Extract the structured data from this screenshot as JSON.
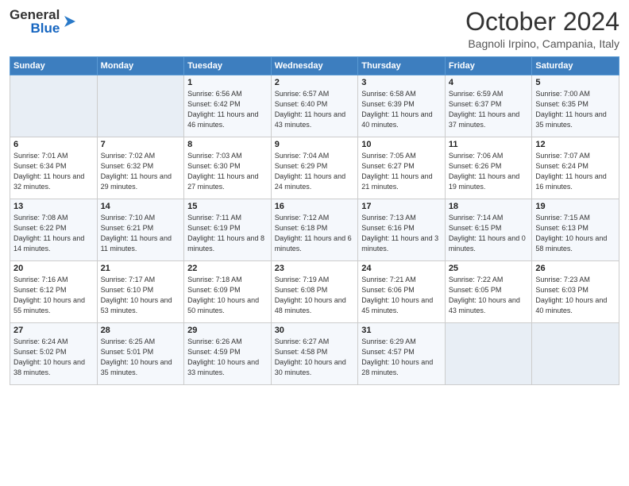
{
  "header": {
    "logo_line1": "General",
    "logo_line2": "Blue",
    "month": "October 2024",
    "location": "Bagnoli Irpino, Campania, Italy"
  },
  "weekdays": [
    "Sunday",
    "Monday",
    "Tuesday",
    "Wednesday",
    "Thursday",
    "Friday",
    "Saturday"
  ],
  "weeks": [
    [
      {
        "day": "",
        "info": ""
      },
      {
        "day": "",
        "info": ""
      },
      {
        "day": "1",
        "info": "Sunrise: 6:56 AM\nSunset: 6:42 PM\nDaylight: 11 hours and 46 minutes."
      },
      {
        "day": "2",
        "info": "Sunrise: 6:57 AM\nSunset: 6:40 PM\nDaylight: 11 hours and 43 minutes."
      },
      {
        "day": "3",
        "info": "Sunrise: 6:58 AM\nSunset: 6:39 PM\nDaylight: 11 hours and 40 minutes."
      },
      {
        "day": "4",
        "info": "Sunrise: 6:59 AM\nSunset: 6:37 PM\nDaylight: 11 hours and 37 minutes."
      },
      {
        "day": "5",
        "info": "Sunrise: 7:00 AM\nSunset: 6:35 PM\nDaylight: 11 hours and 35 minutes."
      }
    ],
    [
      {
        "day": "6",
        "info": "Sunrise: 7:01 AM\nSunset: 6:34 PM\nDaylight: 11 hours and 32 minutes."
      },
      {
        "day": "7",
        "info": "Sunrise: 7:02 AM\nSunset: 6:32 PM\nDaylight: 11 hours and 29 minutes."
      },
      {
        "day": "8",
        "info": "Sunrise: 7:03 AM\nSunset: 6:30 PM\nDaylight: 11 hours and 27 minutes."
      },
      {
        "day": "9",
        "info": "Sunrise: 7:04 AM\nSunset: 6:29 PM\nDaylight: 11 hours and 24 minutes."
      },
      {
        "day": "10",
        "info": "Sunrise: 7:05 AM\nSunset: 6:27 PM\nDaylight: 11 hours and 21 minutes."
      },
      {
        "day": "11",
        "info": "Sunrise: 7:06 AM\nSunset: 6:26 PM\nDaylight: 11 hours and 19 minutes."
      },
      {
        "day": "12",
        "info": "Sunrise: 7:07 AM\nSunset: 6:24 PM\nDaylight: 11 hours and 16 minutes."
      }
    ],
    [
      {
        "day": "13",
        "info": "Sunrise: 7:08 AM\nSunset: 6:22 PM\nDaylight: 11 hours and 14 minutes."
      },
      {
        "day": "14",
        "info": "Sunrise: 7:10 AM\nSunset: 6:21 PM\nDaylight: 11 hours and 11 minutes."
      },
      {
        "day": "15",
        "info": "Sunrise: 7:11 AM\nSunset: 6:19 PM\nDaylight: 11 hours and 8 minutes."
      },
      {
        "day": "16",
        "info": "Sunrise: 7:12 AM\nSunset: 6:18 PM\nDaylight: 11 hours and 6 minutes."
      },
      {
        "day": "17",
        "info": "Sunrise: 7:13 AM\nSunset: 6:16 PM\nDaylight: 11 hours and 3 minutes."
      },
      {
        "day": "18",
        "info": "Sunrise: 7:14 AM\nSunset: 6:15 PM\nDaylight: 11 hours and 0 minutes."
      },
      {
        "day": "19",
        "info": "Sunrise: 7:15 AM\nSunset: 6:13 PM\nDaylight: 10 hours and 58 minutes."
      }
    ],
    [
      {
        "day": "20",
        "info": "Sunrise: 7:16 AM\nSunset: 6:12 PM\nDaylight: 10 hours and 55 minutes."
      },
      {
        "day": "21",
        "info": "Sunrise: 7:17 AM\nSunset: 6:10 PM\nDaylight: 10 hours and 53 minutes."
      },
      {
        "day": "22",
        "info": "Sunrise: 7:18 AM\nSunset: 6:09 PM\nDaylight: 10 hours and 50 minutes."
      },
      {
        "day": "23",
        "info": "Sunrise: 7:19 AM\nSunset: 6:08 PM\nDaylight: 10 hours and 48 minutes."
      },
      {
        "day": "24",
        "info": "Sunrise: 7:21 AM\nSunset: 6:06 PM\nDaylight: 10 hours and 45 minutes."
      },
      {
        "day": "25",
        "info": "Sunrise: 7:22 AM\nSunset: 6:05 PM\nDaylight: 10 hours and 43 minutes."
      },
      {
        "day": "26",
        "info": "Sunrise: 7:23 AM\nSunset: 6:03 PM\nDaylight: 10 hours and 40 minutes."
      }
    ],
    [
      {
        "day": "27",
        "info": "Sunrise: 6:24 AM\nSunset: 5:02 PM\nDaylight: 10 hours and 38 minutes."
      },
      {
        "day": "28",
        "info": "Sunrise: 6:25 AM\nSunset: 5:01 PM\nDaylight: 10 hours and 35 minutes."
      },
      {
        "day": "29",
        "info": "Sunrise: 6:26 AM\nSunset: 4:59 PM\nDaylight: 10 hours and 33 minutes."
      },
      {
        "day": "30",
        "info": "Sunrise: 6:27 AM\nSunset: 4:58 PM\nDaylight: 10 hours and 30 minutes."
      },
      {
        "day": "31",
        "info": "Sunrise: 6:29 AM\nSunset: 4:57 PM\nDaylight: 10 hours and 28 minutes."
      },
      {
        "day": "",
        "info": ""
      },
      {
        "day": "",
        "info": ""
      }
    ]
  ]
}
